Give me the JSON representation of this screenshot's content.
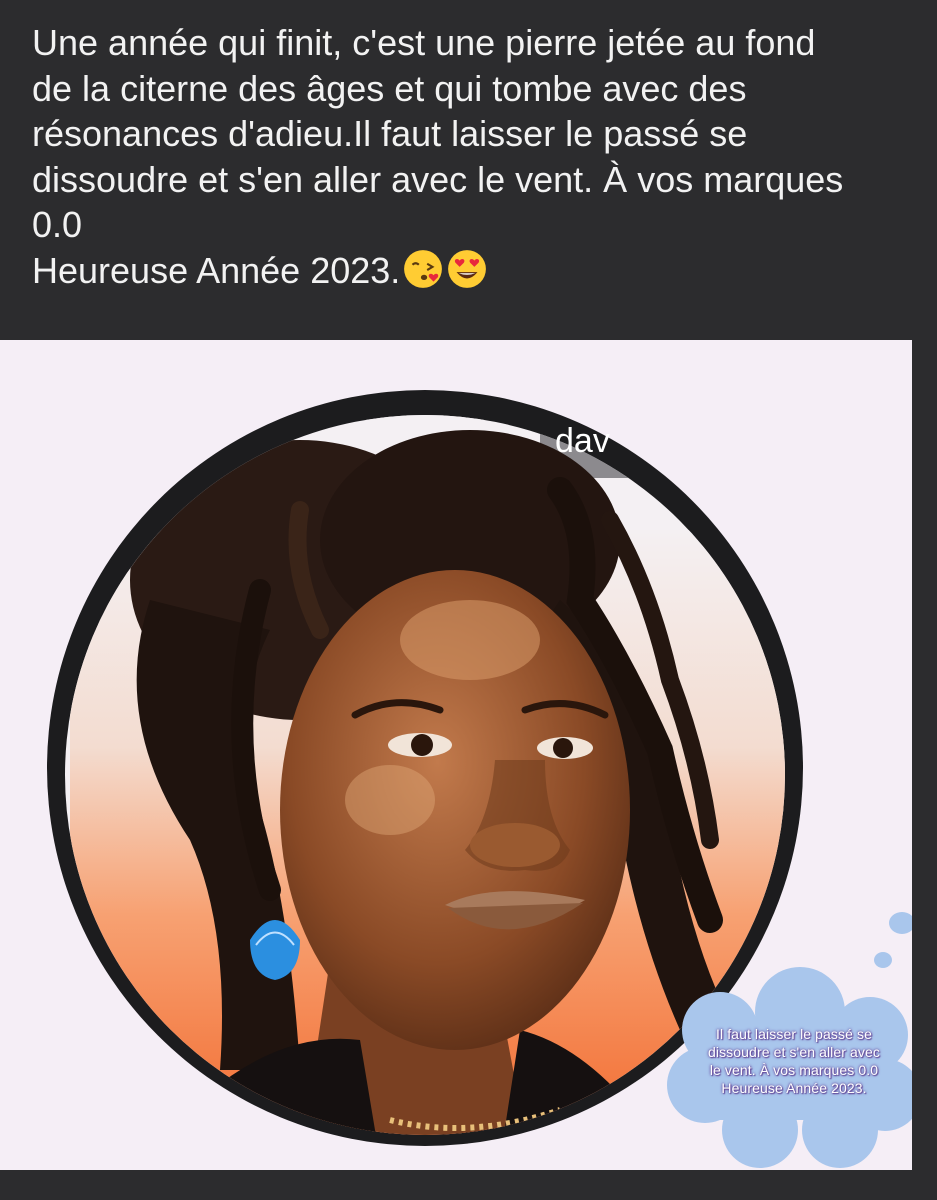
{
  "post": {
    "caption_lines": [
      "Une année qui finit, c'est une pierre jetée au fond",
      "de la citerne des âges et qui tombe avec des",
      "résonances d'adieu.Il faut laisser le passé se",
      "dissoudre et s'en aller avec le vent. À vos marques",
      "0.0",
      "Heureuse Année 2023."
    ],
    "caption_emojis": [
      "face-blowing-kiss-icon",
      "smiling-face-heart-eyes-icon"
    ]
  },
  "image": {
    "watermark_text": "dav",
    "bubble_lines": [
      "Il faut laisser le passé se",
      "dissoudre et s'en aller avec",
      "le vent. À vos marques 0.0",
      "Heureuse Année 2023."
    ]
  },
  "colors": {
    "app_background": "#2c2c2e",
    "caption_text": "#f2f2f2",
    "image_background": "#f5eef6",
    "bubble_fill": "#a9c6ec",
    "portrait_gradient_bottom": "#f26a2e"
  }
}
